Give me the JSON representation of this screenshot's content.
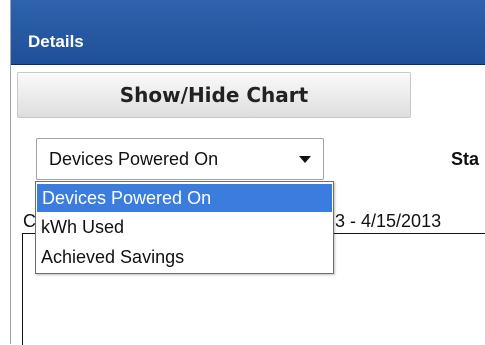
{
  "panel": {
    "title": "Details",
    "toggle_chart_label": "Show/Hide Chart"
  },
  "metric_select": {
    "value": "Devices Powered On",
    "icon": "chevron-down-icon",
    "options": [
      {
        "label": "Devices Powered On",
        "selected": true
      },
      {
        "label": "kWh Used",
        "selected": false
      },
      {
        "label": "Achieved Savings",
        "selected": false
      }
    ]
  },
  "start_label": "Sta",
  "chart": {
    "title_fragment": "C",
    "date_range_fragment": "3 - 4/15/2013"
  },
  "colors": {
    "header": "#2a5ca8",
    "selection": "#3b7ddf"
  }
}
